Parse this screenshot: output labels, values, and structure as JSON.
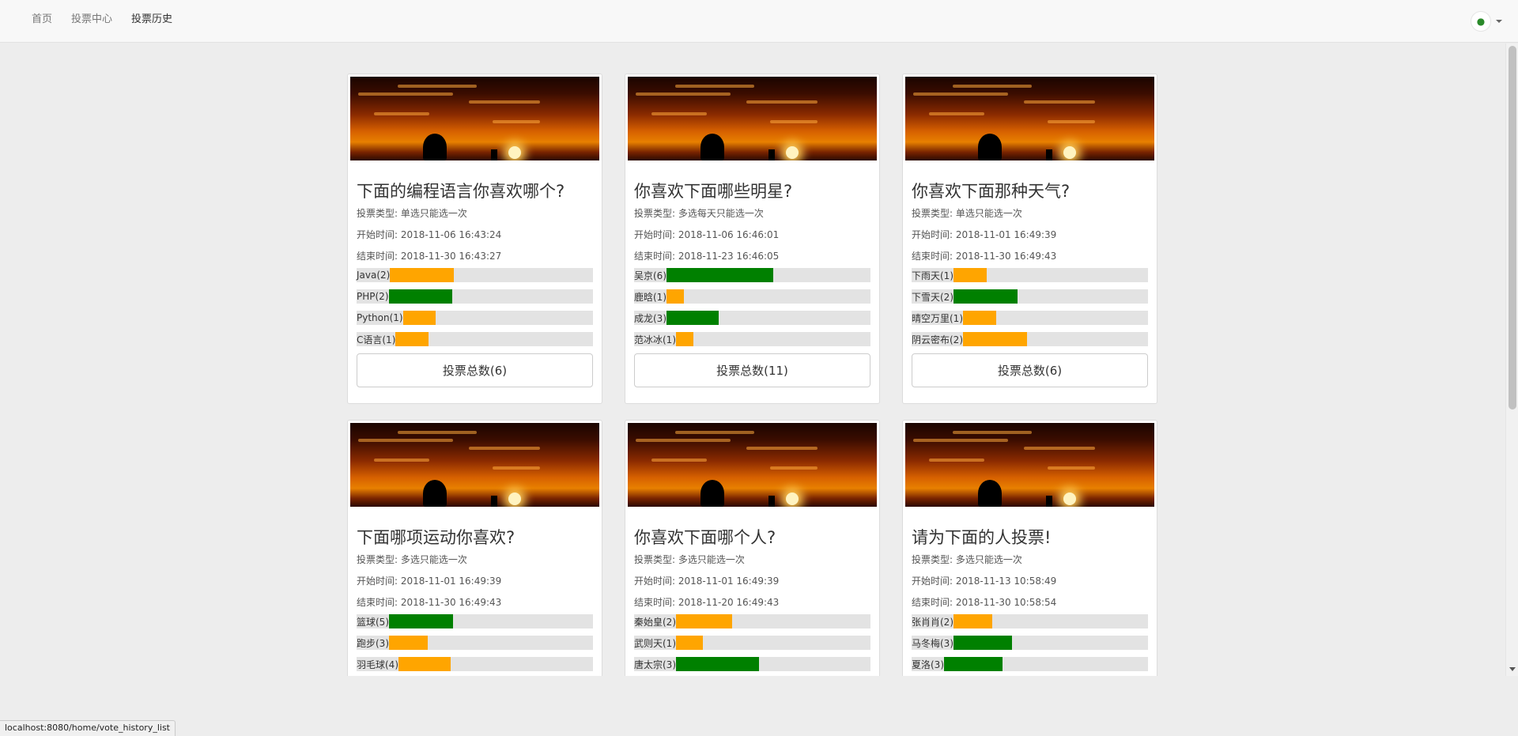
{
  "nav": {
    "items": [
      "首页",
      "投票中心",
      "投票历史"
    ],
    "active_index": 2
  },
  "user": {
    "icon": "user-avatar-icon"
  },
  "colors": {
    "orange": "#ffa500",
    "green": "#008000",
    "track": "#e3e3e3"
  },
  "cards": [
    {
      "title": "下面的编程语言你喜欢哪个?",
      "type": "投票类型: 单选只能选一次",
      "start": "开始时间: 2018-11-06 16:43:24",
      "end": "结束时间: 2018-11-30 16:43:27",
      "options": [
        {
          "label": "Java(2)",
          "fraction": 0.33,
          "color": "#ffa500"
        },
        {
          "label": "PHP(2)",
          "fraction": 0.33,
          "color": "#008000"
        },
        {
          "label": "Python(1)",
          "fraction": 0.17,
          "color": "#ffa500"
        },
        {
          "label": "C语言(1)",
          "fraction": 0.17,
          "color": "#ffa500"
        }
      ],
      "total": "投票总数(6)"
    },
    {
      "title": "你喜欢下面哪些明星?",
      "type": "投票类型: 多选每天只能选一次",
      "start": "开始时间: 2018-11-06 16:46:01",
      "end": "结束时间: 2018-11-23 16:46:05",
      "options": [
        {
          "label": "吴京(6)",
          "fraction": 0.55,
          "color": "#008000"
        },
        {
          "label": "鹿晗(1)",
          "fraction": 0.09,
          "color": "#ffa500"
        },
        {
          "label": "成龙(3)",
          "fraction": 0.27,
          "color": "#008000"
        },
        {
          "label": "范冰冰(1)",
          "fraction": 0.09,
          "color": "#ffa500"
        }
      ],
      "total": "投票总数(11)"
    },
    {
      "title": "你喜欢下面那种天气?",
      "type": "投票类型: 单选只能选一次",
      "start": "开始时间: 2018-11-01 16:49:39",
      "end": "结束时间: 2018-11-30 16:49:43",
      "options": [
        {
          "label": "下雨天(1)",
          "fraction": 0.17,
          "color": "#ffa500"
        },
        {
          "label": "下雪天(2)",
          "fraction": 0.33,
          "color": "#008000"
        },
        {
          "label": "晴空万里(1)",
          "fraction": 0.17,
          "color": "#ffa500"
        },
        {
          "label": "阴云密布(2)",
          "fraction": 0.33,
          "color": "#ffa500"
        }
      ],
      "total": "投票总数(6)"
    },
    {
      "title": "下面哪项运动你喜欢?",
      "type": "投票类型: 多选只能选一次",
      "start": "开始时间: 2018-11-01 16:49:39",
      "end": "结束时间: 2018-11-30 16:49:43",
      "options": [
        {
          "label": "篮球(5)",
          "fraction": 0.33,
          "color": "#008000"
        },
        {
          "label": "跑步(3)",
          "fraction": 0.2,
          "color": "#ffa500"
        },
        {
          "label": "羽毛球(4)",
          "fraction": 0.27,
          "color": "#ffa500"
        }
      ],
      "total": ""
    },
    {
      "title": "你喜欢下面哪个人?",
      "type": "投票类型: 多选只能选一次",
      "start": "开始时间: 2018-11-01 16:49:39",
      "end": "结束时间: 2018-11-20 16:49:43",
      "options": [
        {
          "label": "秦始皇(2)",
          "fraction": 0.29,
          "color": "#ffa500"
        },
        {
          "label": "武则天(1)",
          "fraction": 0.14,
          "color": "#ffa500"
        },
        {
          "label": "唐太宗(3)",
          "fraction": 0.43,
          "color": "#008000"
        }
      ],
      "total": ""
    },
    {
      "title": "请为下面的人投票!",
      "type": "投票类型: 多选只能选一次",
      "start": "开始时间: 2018-11-13 10:58:49",
      "end": "结束时间: 2018-11-30 10:58:54",
      "options": [
        {
          "label": "张肖肖(2)",
          "fraction": 0.2,
          "color": "#ffa500"
        },
        {
          "label": "马冬梅(3)",
          "fraction": 0.3,
          "color": "#008000"
        },
        {
          "label": "夏洛(3)",
          "fraction": 0.3,
          "color": "#008000"
        }
      ],
      "total": ""
    }
  ],
  "status_url": "localhost:8080/home/vote_history_list"
}
